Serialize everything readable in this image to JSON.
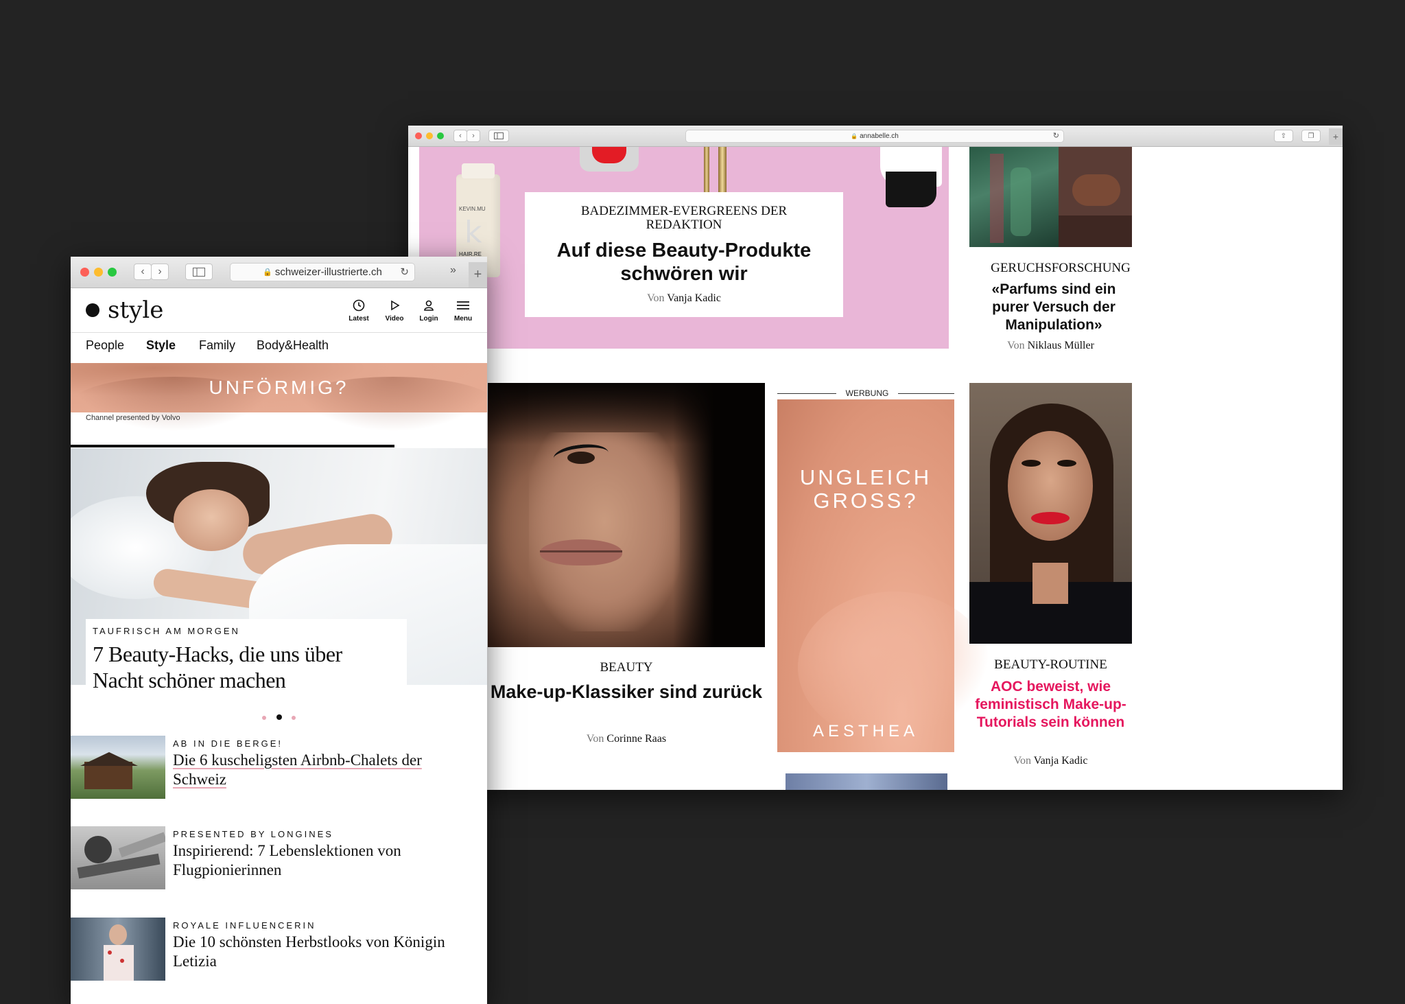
{
  "back_window": {
    "url": "annabelle.ch",
    "hero": {
      "kicker": "BADEZIMMER-EVERGREENS DER REDAKTION",
      "title": "Auf diese Beauty-Produkte schwören wir",
      "by": "Von",
      "author": "Vanja Kadic"
    },
    "article_right_top": {
      "kicker": "GERUCHSFORSCHUNG",
      "title": "«Parfums sind ein purer Versuch der Manipulation»",
      "by": "Von",
      "author": "Niklaus Müller"
    },
    "article_face": {
      "kicker": "BEAUTY",
      "title": "Make-up-Klassiker sind zurück",
      "by": "Von",
      "author": "Corinne Raas"
    },
    "ad": {
      "label": "WERBUNG",
      "line1": "UNGLEICH",
      "line2": "GROSS?",
      "brand": "AESTHEA"
    },
    "article_aoc": {
      "kicker": "BEAUTY-ROUTINE",
      "title": "AOC beweist, wie feministisch Make-up-Tutorials sein können",
      "by": "Von",
      "author": "Vanja Kadic"
    },
    "product_label_1": "KEVIN.MU",
    "product_label_2": "HAIR.RE"
  },
  "front_window": {
    "url": "schweizer-illustrierte.ch",
    "logo": "style",
    "header_actions": [
      {
        "label": "Latest",
        "icon": "clock-icon"
      },
      {
        "label": "Video",
        "icon": "play-icon"
      },
      {
        "label": "Login",
        "icon": "user-icon"
      },
      {
        "label": "Menu",
        "icon": "hamburger-icon"
      }
    ],
    "nav": [
      "People",
      "Style",
      "Family",
      "Body&Health"
    ],
    "nav_active": "Style",
    "banner": {
      "text": "UNFÖRMIG?",
      "sponsor": "Channel presented by Volvo"
    },
    "hero": {
      "kicker": "TAUFRISCH AM MORGEN",
      "title": "7 Beauty-Hacks, die uns über Nacht schöner machen"
    },
    "list": [
      {
        "kicker": "AB IN DIE BERGE!",
        "title": "Die 6 kuscheligsten Airbnb-Chalets der Schweiz"
      },
      {
        "kicker": "PRESENTED BY LONGINES",
        "title": "Inspirierend: 7 Lebenslektionen von Flugpionierinnen"
      },
      {
        "kicker": "ROYALE INFLUENCERIN",
        "title": "Die 10 schönsten Herbstlooks von Königin Letizia"
      }
    ]
  },
  "colors": {
    "background": "#232323",
    "accent_pink": "#e5175e",
    "peach": "#e7a287",
    "pink_bg": "#e9b6d7"
  }
}
